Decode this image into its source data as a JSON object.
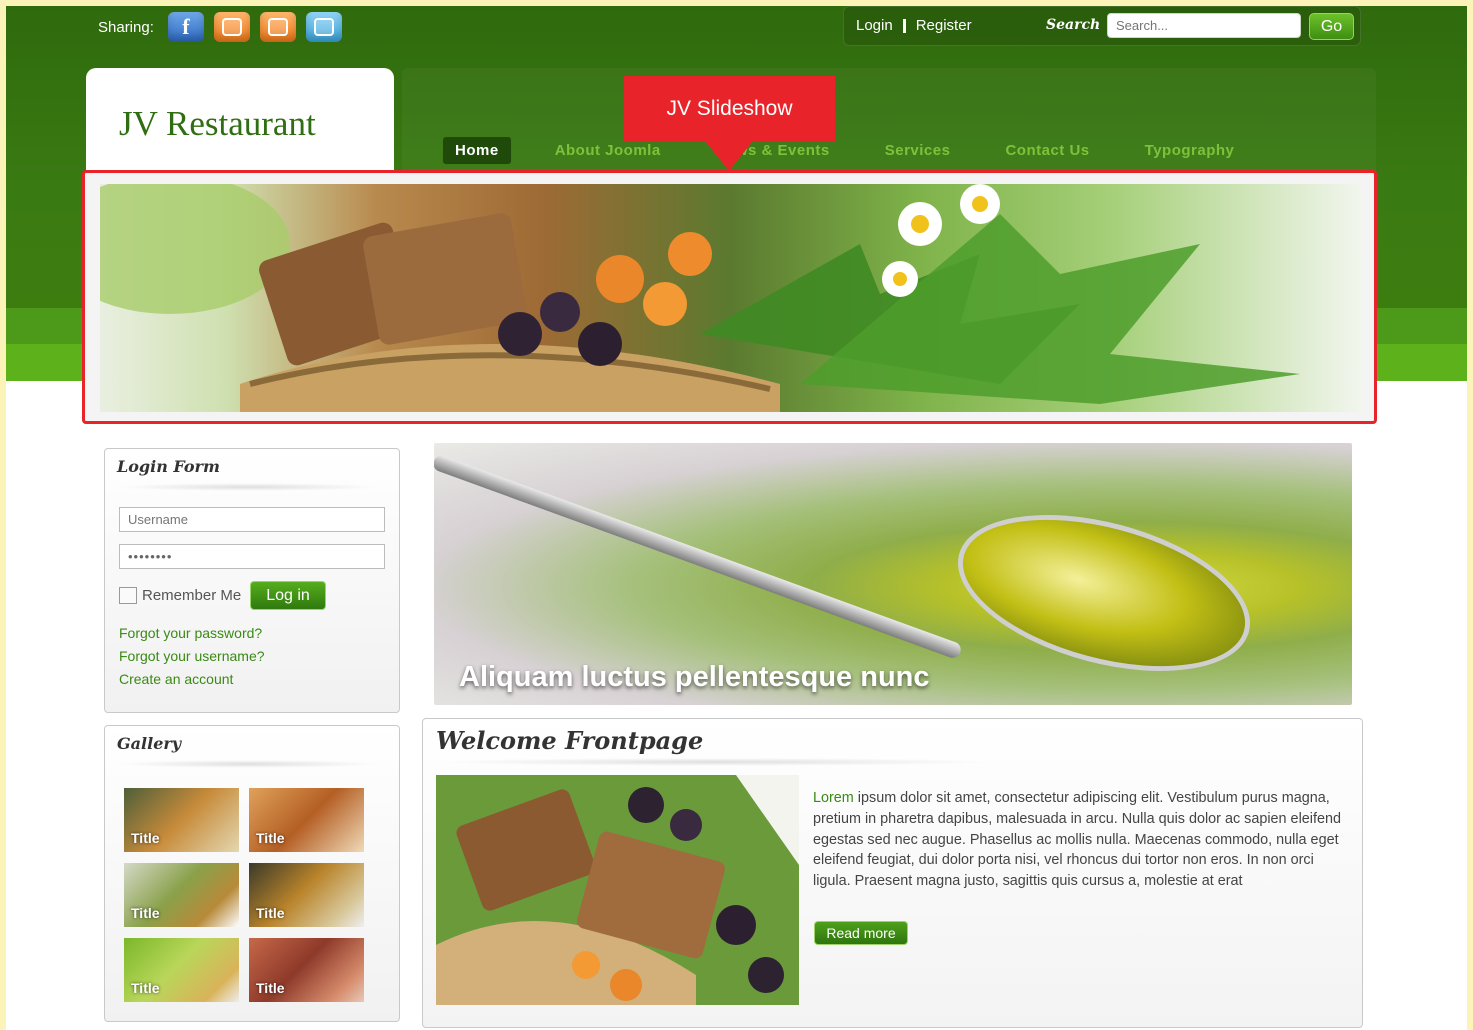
{
  "header": {
    "sharing_label": "Sharing:",
    "social_icons": [
      "facebook-icon",
      "blogger-icon",
      "blog-icon",
      "twitter-icon"
    ],
    "login_link": "Login",
    "register_link": "Register",
    "search_label": "Search",
    "search_placeholder": "Search...",
    "go_label": "Go"
  },
  "logo": {
    "title": "JV Restaurant"
  },
  "nav": {
    "items": [
      {
        "label": "Home"
      },
      {
        "label": "About Joomla"
      },
      {
        "label": "News & Events"
      },
      {
        "label": "Services"
      },
      {
        "label": "Contact Us"
      },
      {
        "label": "Typography"
      }
    ]
  },
  "callout": {
    "label": "JV Slideshow"
  },
  "login_form": {
    "title": "Login Form",
    "username_placeholder": "Username",
    "password_value": "••••••••",
    "remember_label": "Remember Me",
    "login_button": "Log in",
    "forgot_password": "Forgot your password?",
    "forgot_username": "Forgot your username?",
    "create_account": "Create an account"
  },
  "gallery": {
    "title": "Gallery",
    "items": [
      {
        "label": "Title"
      },
      {
        "label": "Title"
      },
      {
        "label": "Title"
      },
      {
        "label": "Title"
      },
      {
        "label": "Title"
      },
      {
        "label": "Title"
      }
    ]
  },
  "banner": {
    "caption": "Aliquam luctus pellentesque nunc"
  },
  "welcome": {
    "title": "Welcome Frontpage",
    "text_first": "Lorem",
    "text_rest": " ipsum dolor sit amet, consectetur adipiscing elit. Vestibulum purus magna, pretium in pharetra dapibus, malesuada in arcu. Nulla quis dolor ac sapien eleifend egestas sed nec augue. Phasellus ac mollis nulla. Maecenas commodo, nulla eget eleifend feugiat, dui dolor porta nisi, vel rhoncus dui tortor non eros. In non orci ligula. Praesent magna justo, sagittis quis cursus a, molestie at erat",
    "read_more": "Read more"
  },
  "colors": {
    "header_green": "#2f6a0d",
    "accent_green": "#5db21c",
    "callout_red": "#e8232a",
    "link_green": "#3a8a14"
  }
}
